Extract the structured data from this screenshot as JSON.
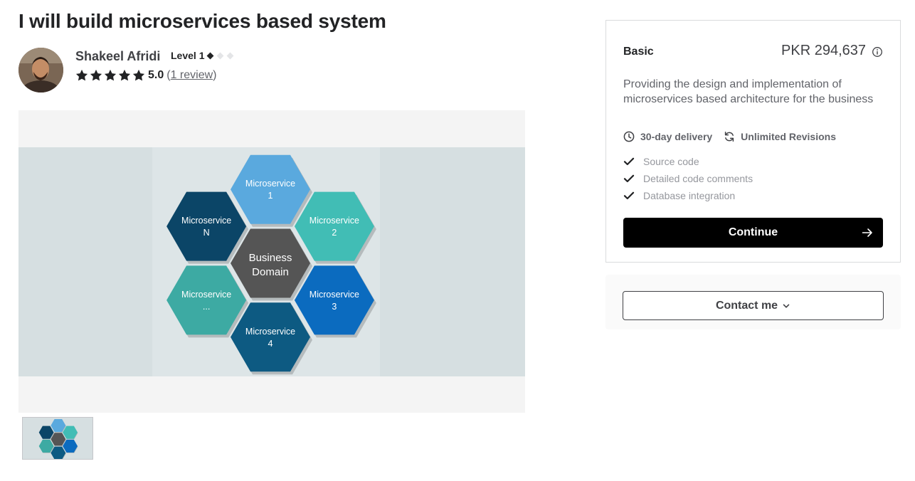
{
  "gig": {
    "title": "I will build microservices based system"
  },
  "seller": {
    "name": "Shakeel Afridi",
    "level": "Level 1",
    "rating": "5.0",
    "review_open": "(",
    "review_link": "1 review",
    "review_close": ")"
  },
  "gallery": {
    "diagram": {
      "center": [
        "Business",
        "Domain"
      ],
      "hexagons": [
        {
          "line1": "Microservice",
          "line2": "1",
          "color": "#5aa9de"
        },
        {
          "line1": "Microservice",
          "line2": "2",
          "color": "#41bdb5"
        },
        {
          "line1": "Microservice",
          "line2": "3",
          "color": "#0b6bbf"
        },
        {
          "line1": "Microservice",
          "line2": "4",
          "color": "#0d5a82"
        },
        {
          "line1": "Microservice",
          "line2": "...",
          "color": "#3daaa3"
        },
        {
          "line1": "Microservice",
          "line2": "N",
          "color": "#0b4567"
        }
      ],
      "center_color": "#555555"
    }
  },
  "package": {
    "name": "Basic",
    "price": "PKR 294,637",
    "description": "Providing the design and implementation of microservices based architecture for the business",
    "delivery": "30-day delivery",
    "revisions": "Unlimited Revisions",
    "features": [
      "Source code",
      "Detailed code comments",
      "Database integration"
    ],
    "continue_label": "Continue",
    "icons": [
      "info-icon",
      "clock-icon",
      "refresh-icon",
      "check-icon",
      "arrow-right-icon"
    ]
  },
  "contact": {
    "label": "Contact me",
    "icon": "chevron-down-icon"
  }
}
